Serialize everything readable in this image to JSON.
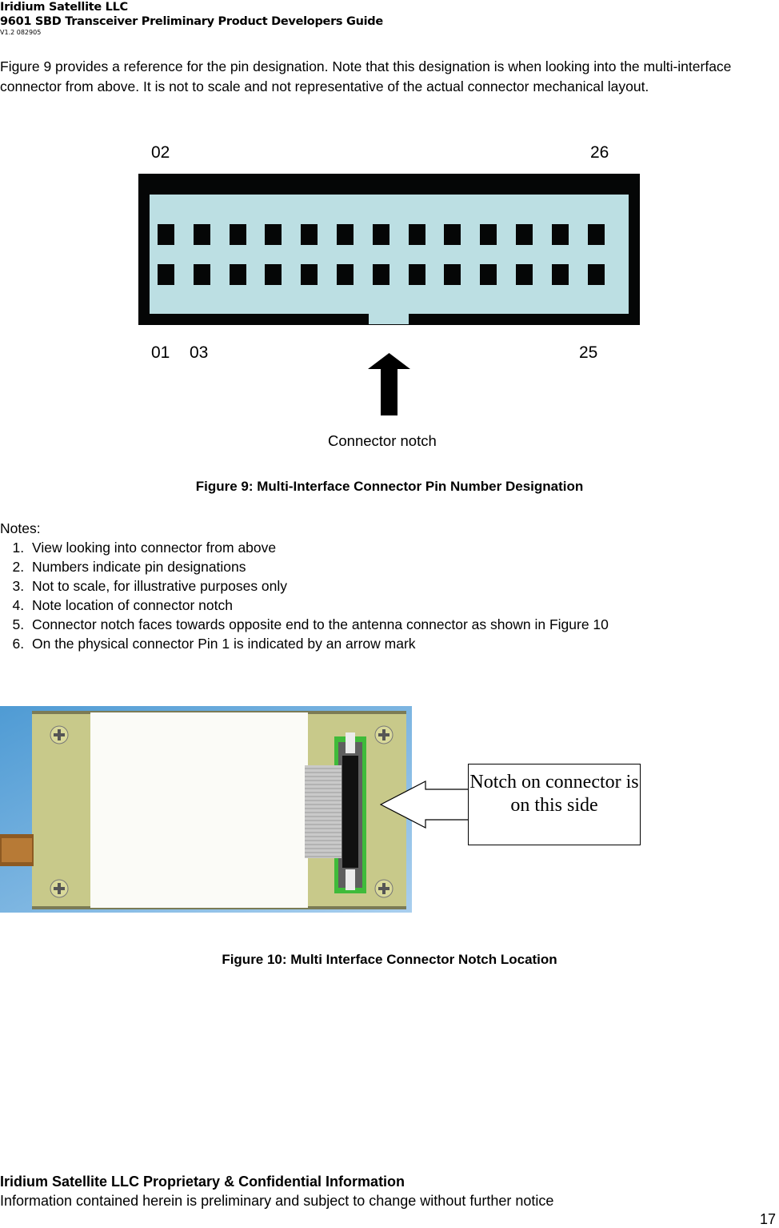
{
  "header": {
    "company": "Iridium Satellite LLC",
    "title": "9601 SBD Transceiver Preliminary Product Developers Guide",
    "version": "V1.2 082905"
  },
  "intro_text": "Figure 9 provides a reference for the pin designation. Note that this designation is when looking into the multi-interface connector from above. It is not to scale and not representative of the actual connector mechanical layout.",
  "figure9": {
    "pin_labels": {
      "top_left": "02",
      "top_right": "26",
      "bottom_left_1": "01",
      "bottom_left_2": "03",
      "bottom_right": "25"
    },
    "pins_per_row": 13,
    "rows": 2,
    "notch_label": "Connector notch",
    "caption": "Figure 9: Multi-Interface Connector Pin Number Designation",
    "colors": {
      "body": "#050606",
      "face": "#bcdfe3"
    }
  },
  "notes": {
    "heading": "Notes:",
    "items": [
      "View looking into connector from above",
      "Numbers indicate pin designations",
      "Not to scale, for illustrative purposes only",
      "Note location of connector notch",
      "Connector notch faces towards opposite end to the antenna connector as shown in Figure 10",
      "On the physical connector Pin 1 is indicated by an arrow mark"
    ]
  },
  "figure10": {
    "callout": "Notch on connector is on this side",
    "caption": "Figure 10: Multi Interface Connector Notch Location"
  },
  "footer": {
    "line1": "Iridium Satellite LLC Proprietary & Confidential Information",
    "line2": "Information contained herein is preliminary and subject to change without further notice",
    "page_number": "17"
  }
}
